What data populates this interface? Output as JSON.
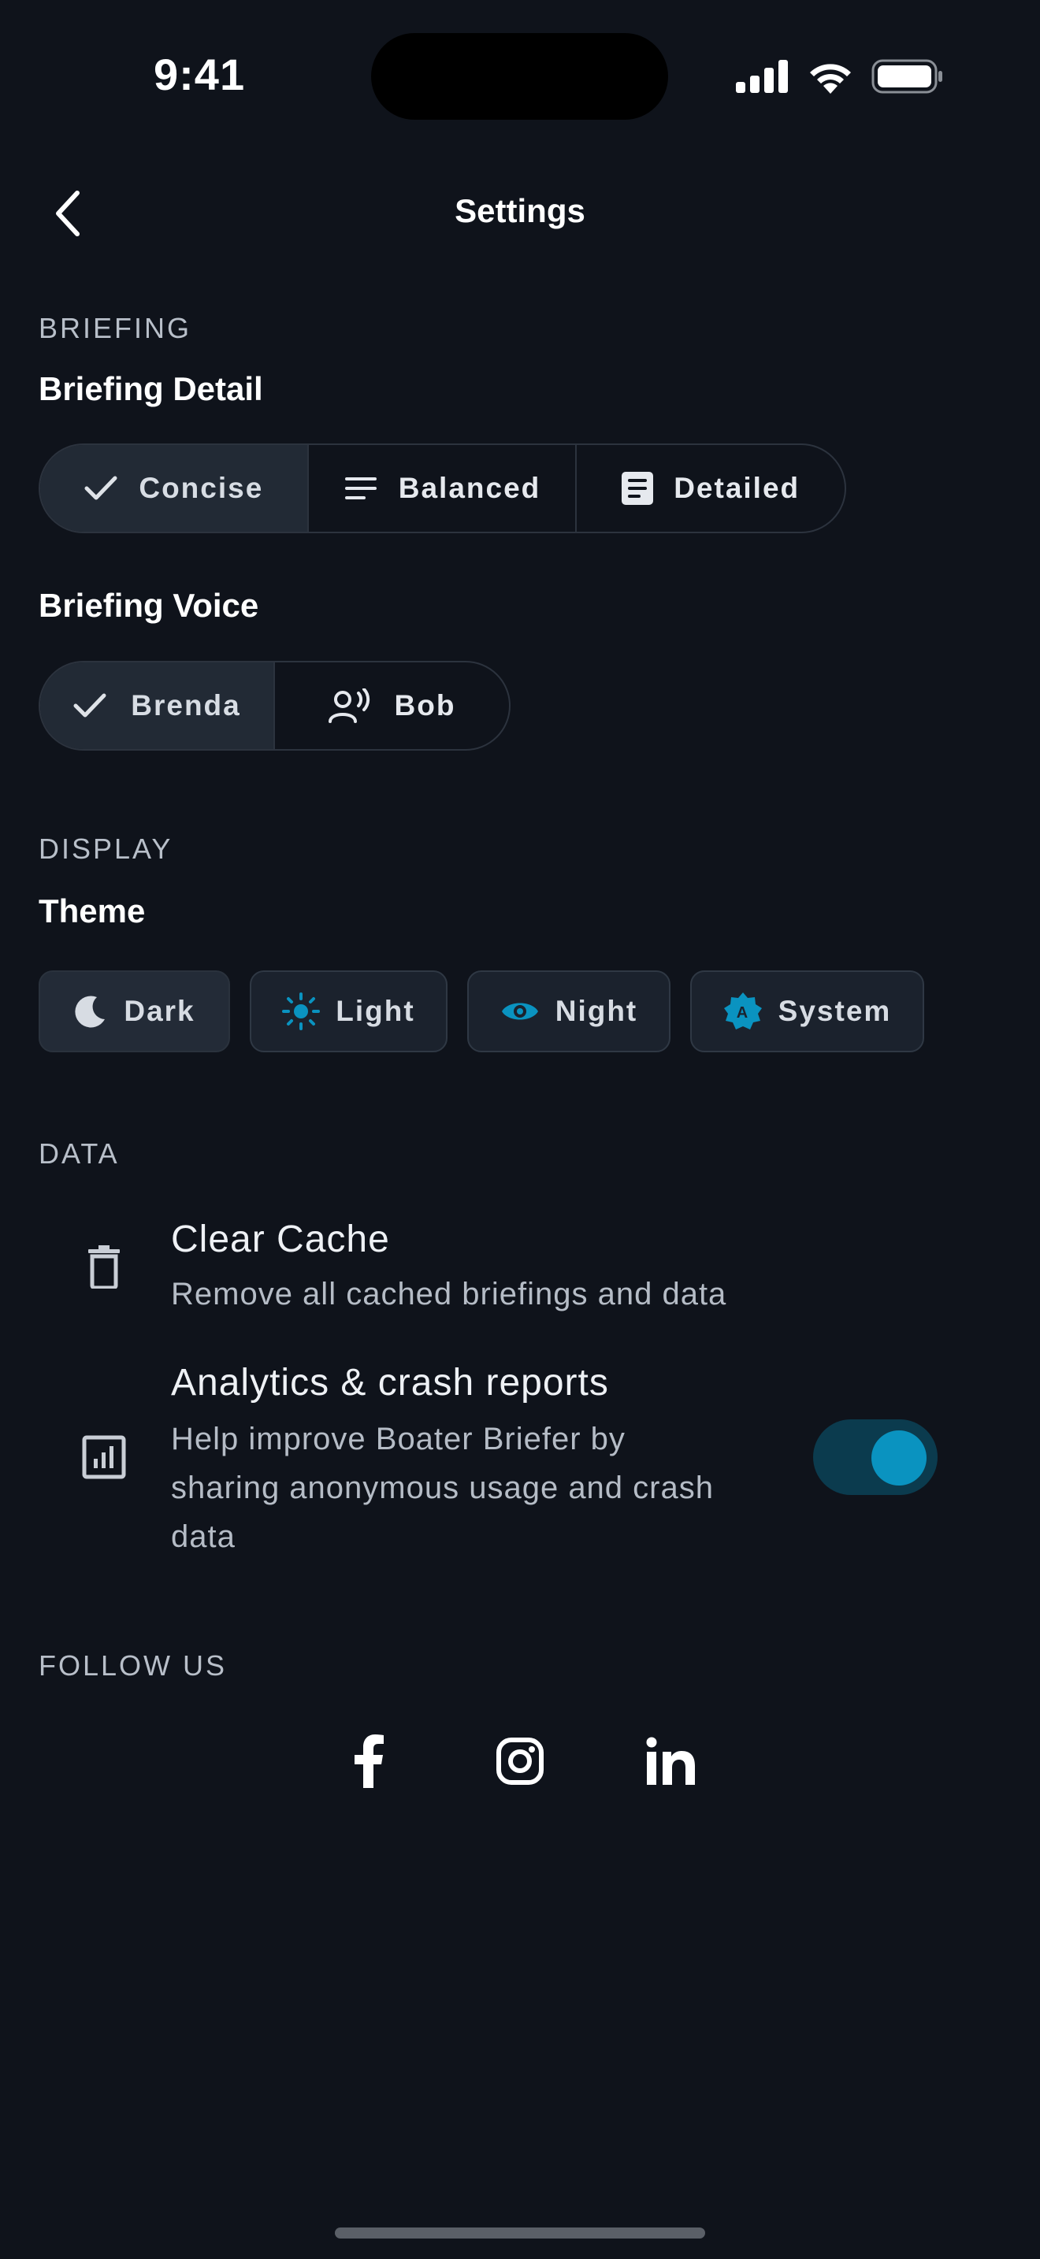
{
  "status_bar": {
    "time": "9:41"
  },
  "header": {
    "title": "Settings"
  },
  "briefing": {
    "section_label": "BRIEFING",
    "detail": {
      "title": "Briefing Detail",
      "options": [
        {
          "label": "Concise",
          "icon": "check-icon",
          "selected": true
        },
        {
          "label": "Balanced",
          "icon": "lines-icon",
          "selected": false
        },
        {
          "label": "Detailed",
          "icon": "document-icon",
          "selected": false
        }
      ]
    },
    "voice": {
      "title": "Briefing Voice",
      "options": [
        {
          "label": "Brenda",
          "icon": "check-icon",
          "selected": true
        },
        {
          "label": "Bob",
          "icon": "voice-person-icon",
          "selected": false
        }
      ]
    }
  },
  "display": {
    "section_label": "DISPLAY",
    "theme": {
      "title": "Theme",
      "options": [
        {
          "label": "Dark",
          "icon": "moon-icon",
          "selected": true
        },
        {
          "label": "Light",
          "icon": "sun-icon",
          "selected": false
        },
        {
          "label": "Night",
          "icon": "eye-icon",
          "selected": false
        },
        {
          "label": "System",
          "icon": "auto-brightness-icon",
          "selected": false
        }
      ]
    }
  },
  "data": {
    "section_label": "DATA",
    "clear_cache": {
      "title": "Clear Cache",
      "subtitle": "Remove all cached briefings and data",
      "icon": "trash-icon"
    },
    "analytics": {
      "title": "Analytics & crash reports",
      "subtitle_lines": [
        "Help improve Boater Briefer by",
        "sharing anonymous usage and crash",
        "data"
      ],
      "icon": "analytics-icon",
      "enabled": true
    }
  },
  "follow": {
    "section_label": "FOLLOW US",
    "links": [
      "facebook-icon",
      "instagram-icon",
      "linkedin-icon"
    ]
  },
  "colors": {
    "background": "#0f131b",
    "accent": "#0a93c0",
    "selected_segment": "#222a35",
    "border": "#2c333e"
  }
}
